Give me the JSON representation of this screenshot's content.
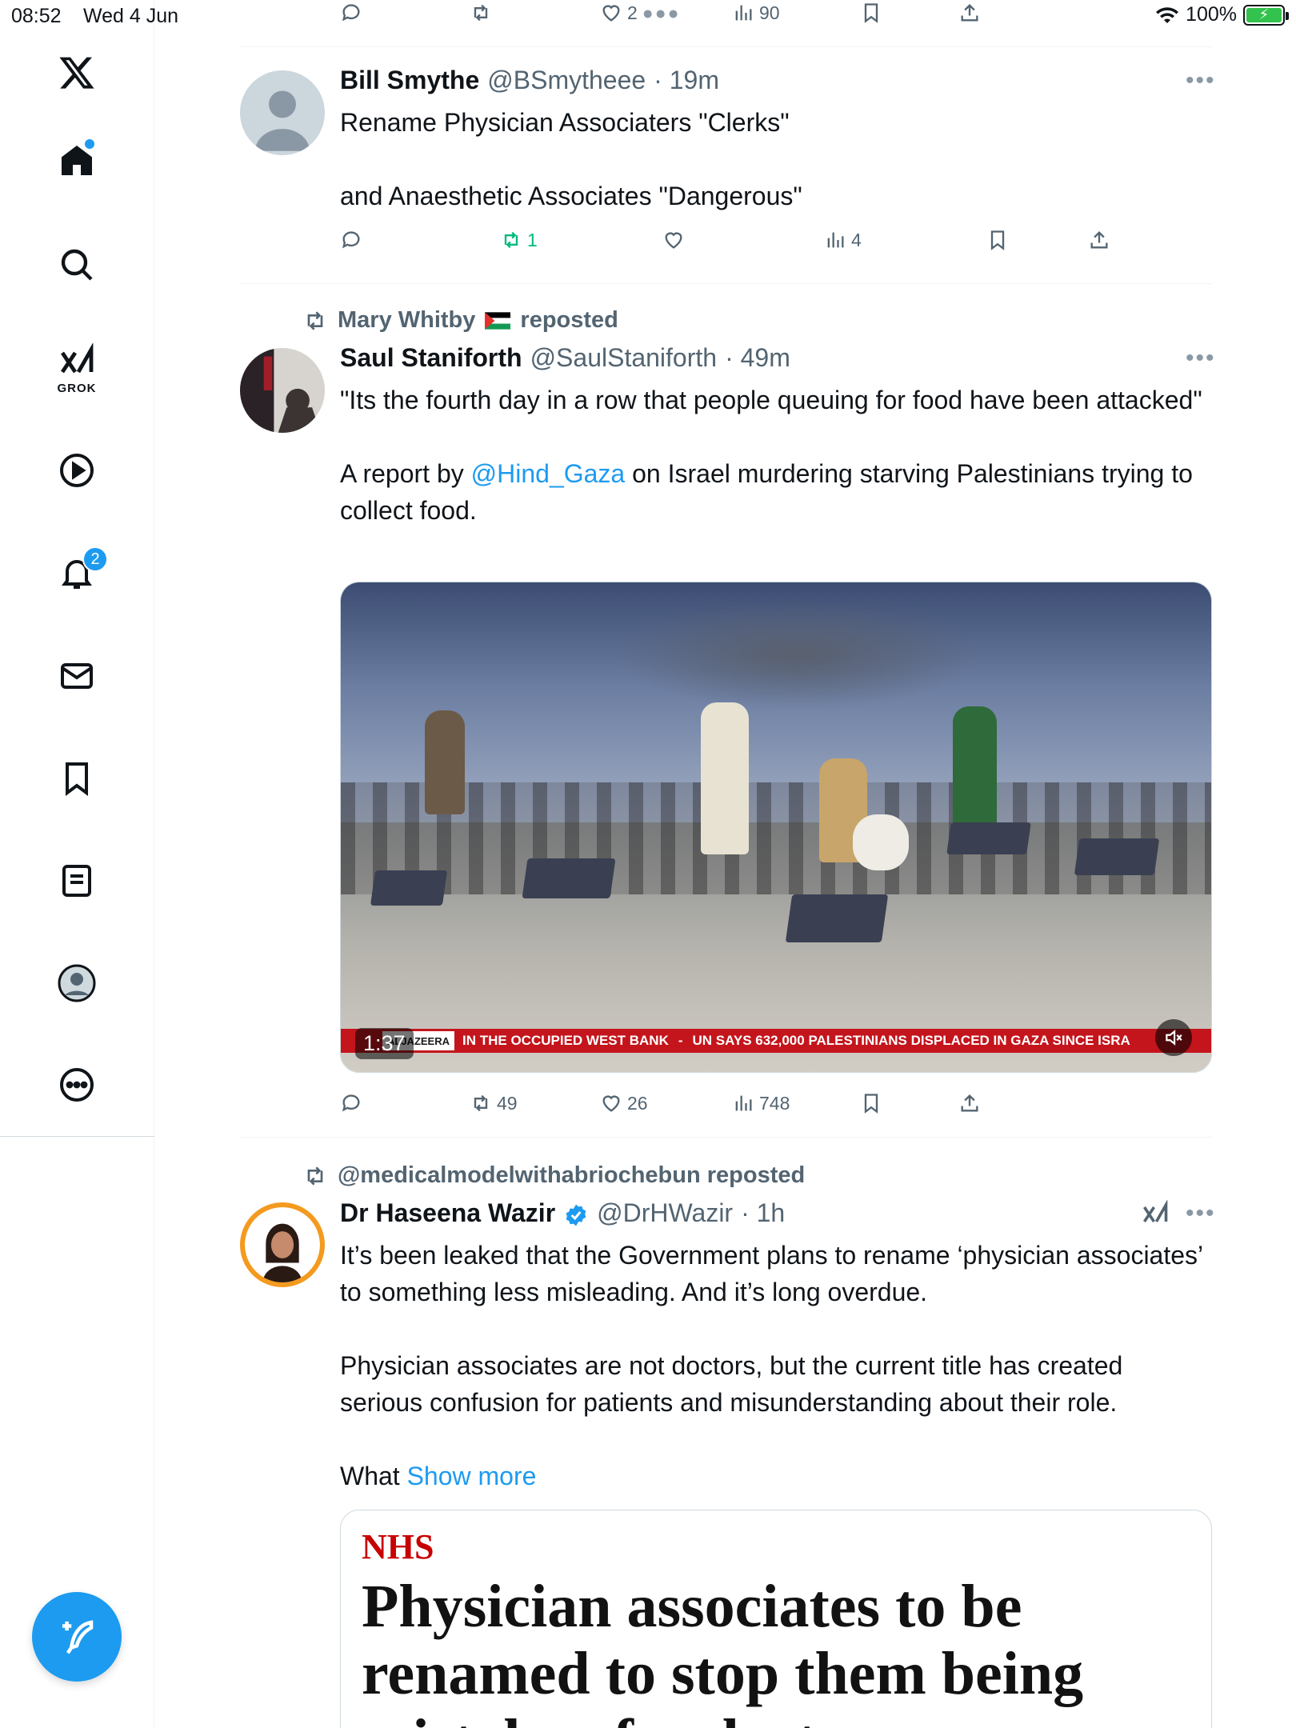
{
  "status_bar": {
    "time": "08:52",
    "date": "Wed 4 Jun",
    "battery": "100%"
  },
  "sidebar": {
    "grok_label": "GROK",
    "notifications_badge": "2"
  },
  "top_actions": {
    "likes": "2",
    "views": "90"
  },
  "tweets": [
    {
      "name": "Bill Smythe",
      "handle": "@BSmytheee",
      "time": "· 19m",
      "text_lines": [
        "Rename Physician Associaters \"Clerks\"",
        "and Anaesthetic Associates \"Dangerous\""
      ],
      "retweets": "1",
      "views": "4"
    },
    {
      "reposted_by": "Mary Whitby",
      "reposted_suffix": "reposted",
      "name": "Saul Staniforth",
      "handle": "@SaulStaniforth",
      "time": "· 49m",
      "text_1": "\"Its the fourth day in a row that people queuing for food have been attacked\"",
      "text_2_prefix": "A report by ",
      "text_2_mention": "@Hind_Gaza",
      "text_2_suffix": " on Israel murdering starving Palestinians trying to collect food.",
      "video": {
        "duration": "1:37",
        "ticker_tag": "ALJAZEERA",
        "ticker_1": "IN THE OCCUPIED WEST BANK",
        "ticker_sep": "-",
        "ticker_2": "UN SAYS 632,000 PALESTINIANS DISPLACED IN GAZA SINCE ISRA"
      },
      "retweets": "49",
      "likes": "26",
      "views": "748"
    },
    {
      "reposted_by": "@medicalmodelwithabriochebun reposted",
      "name": "Dr Haseena Wazir",
      "handle": "@DrHWazir",
      "time": "· 1h",
      "text_1": "It’s been leaked that the Government plans to rename ‘physician associates’ to something less misleading. And it’s long overdue.",
      "text_2": "Physician associates are not doctors, but the current title has created serious confusion for patients and misunderstanding about their role.",
      "text_3": "What",
      "show_more": "Show more",
      "card": {
        "section": "NHS",
        "headline": "Physician associates to be renamed to stop them being mistaken for doctors"
      }
    }
  ],
  "colors": {
    "accent": "#1d9bf0",
    "retweet_green": "#00ba7c",
    "muted": "#536471"
  }
}
